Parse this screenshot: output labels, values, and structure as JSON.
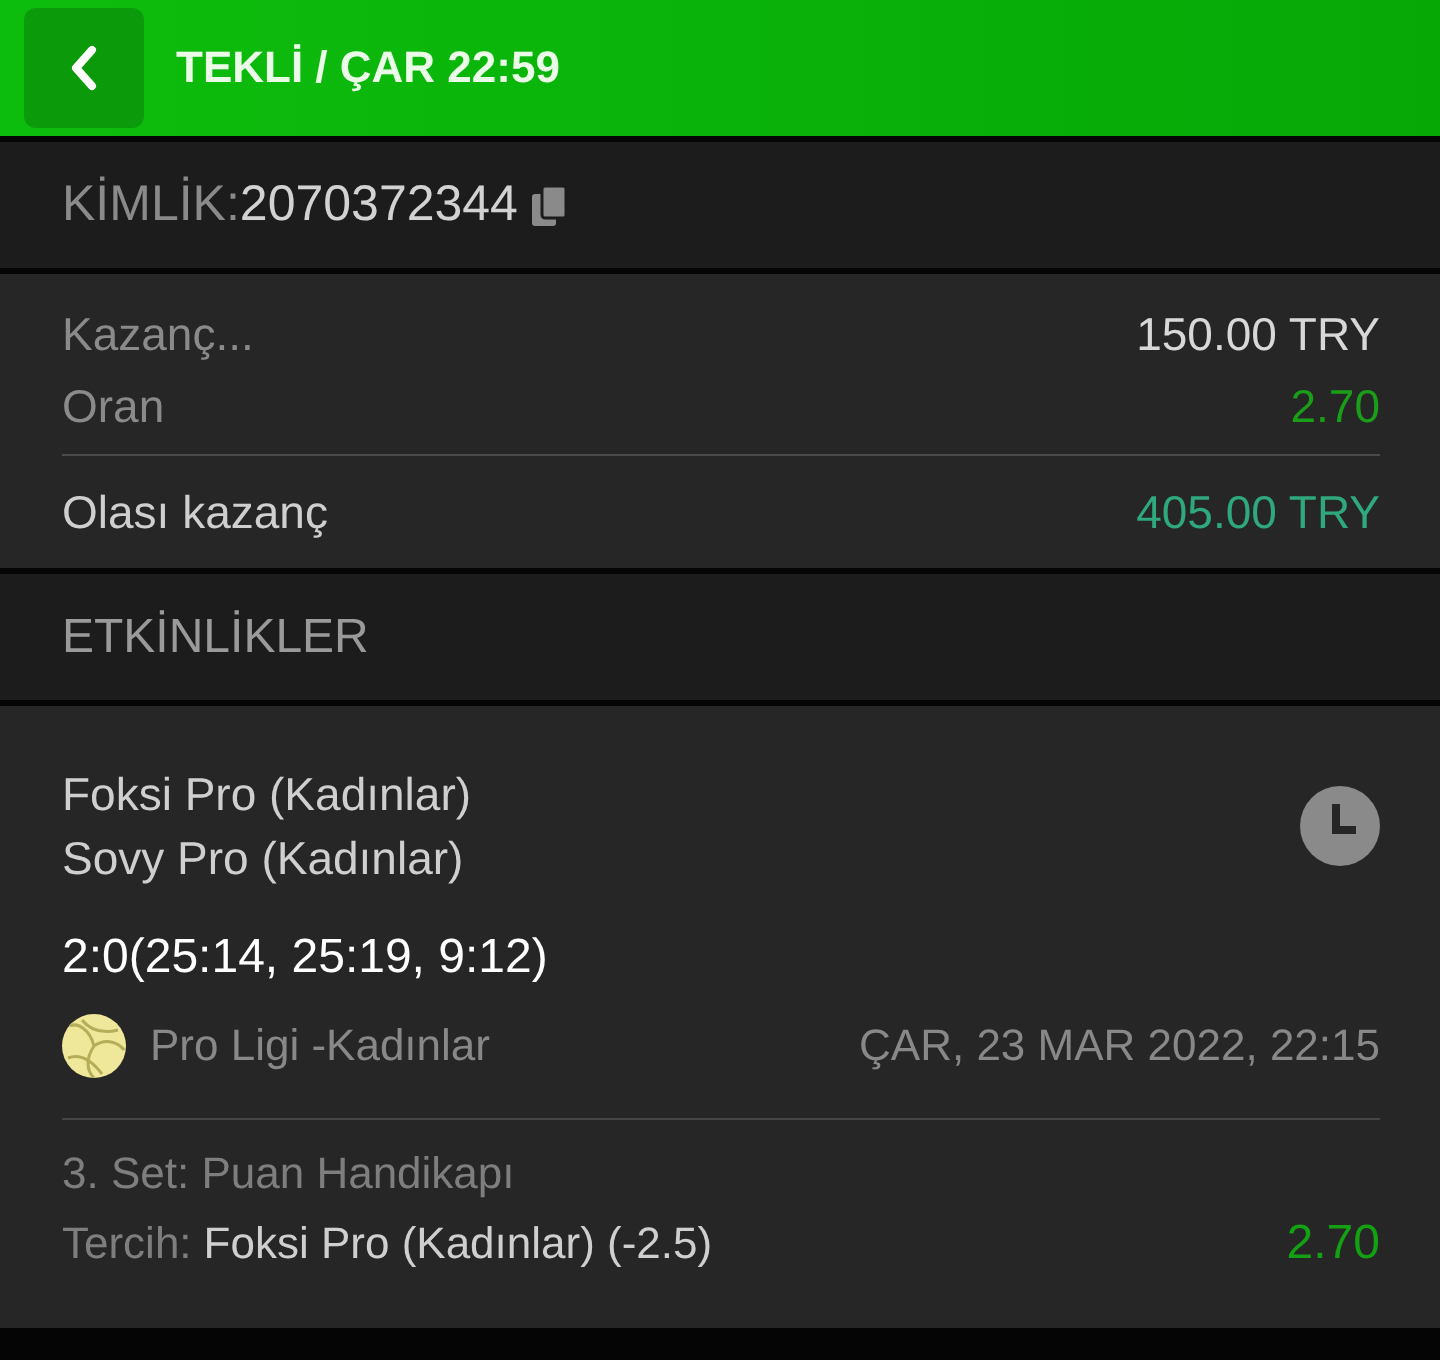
{
  "header": {
    "title": "TEKLİ / ÇAR 22:59"
  },
  "id_row": {
    "label": "KİMLİK:",
    "value": "2070372344"
  },
  "summary": [
    {
      "label": "Kazanç...",
      "value": "150.00 TRY",
      "kind": "plain"
    },
    {
      "label": "Oran",
      "value": "2.70",
      "kind": "odds"
    },
    {
      "label": "Olası kazanç",
      "value": "405.00 TRY",
      "kind": "total"
    }
  ],
  "section_title": "ETKİNLİKLER",
  "event": {
    "teams": [
      "Foksi Pro (Kadınlar)",
      "Sovy Pro (Kadınlar)"
    ],
    "score": "2:0(25:14, 25:19, 9:12)",
    "league": "Pro Ligi -Kadınlar",
    "date": "ÇAR, 23 MAR 2022, 22:15",
    "market": "3. Set: Puan Handikapı",
    "pick_label": "Tercih:",
    "pick": "Foksi Pro (Kadınlar) (-2.5)",
    "odds": "2.70"
  }
}
